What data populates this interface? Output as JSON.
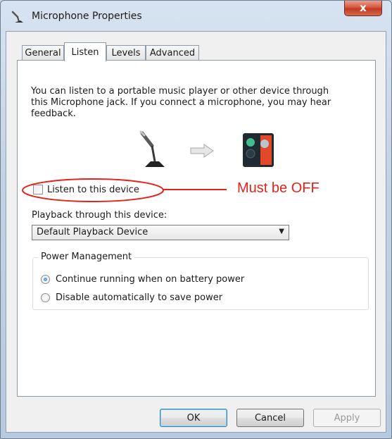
{
  "window": {
    "title": "Microphone Properties",
    "close_glyph": "x"
  },
  "tabs": [
    {
      "label": "General",
      "active": false
    },
    {
      "label": "Listen",
      "active": true
    },
    {
      "label": "Levels",
      "active": false
    },
    {
      "label": "Advanced",
      "active": false
    }
  ],
  "listen": {
    "description": "You can listen to a portable music player or other device through\nthis Microphone jack.  If you connect a microphone, you may hear\nfeedback.",
    "listen_checkbox_label": "Listen to this device",
    "listen_checked": false,
    "playback_label": "Playback through this device:",
    "playback_device": "Default Playback Device"
  },
  "power": {
    "group_title": "Power Management",
    "option_continue": "Continue running when on battery power",
    "option_disable": "Disable automatically to save power",
    "selected": "continue"
  },
  "annotation": {
    "text": "Must be OFF",
    "color": "#e4231b"
  },
  "buttons": {
    "ok": "OK",
    "cancel": "Cancel",
    "apply": "Apply"
  },
  "icons": [
    "microphone-icon",
    "arrow-right-icon",
    "speaker-device-icon",
    "close-icon",
    "dropdown-arrow-icon"
  ]
}
